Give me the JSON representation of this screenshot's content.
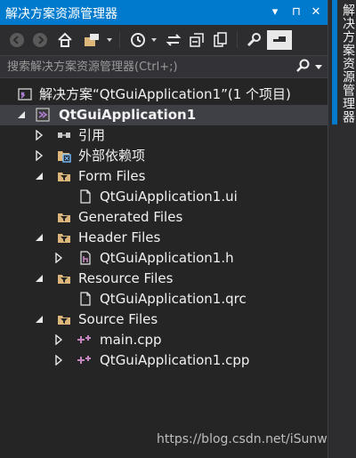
{
  "window": {
    "title": "解决方案资源管理器"
  },
  "title_controls": [
    "▾",
    "⊓",
    "✕"
  ],
  "search": {
    "placeholder": "搜索解决方案资源管理器(Ctrl+;)"
  },
  "sidebar_tab": {
    "label": "解决方案资源管理器"
  },
  "tree": [
    {
      "label": "解决方案“QtGuiApplication1”(1 个项目)",
      "icon": "solution-icon"
    },
    {
      "label": "QtGuiApplication1",
      "icon": "project-icon"
    },
    {
      "label": "引用",
      "icon": "references-icon"
    },
    {
      "label": "外部依赖项",
      "icon": "external-deps-icon"
    },
    {
      "label": "Form Files",
      "icon": "filter-folder-icon"
    },
    {
      "label": "QtGuiApplication1.ui",
      "icon": "file-icon"
    },
    {
      "label": "Generated Files",
      "icon": "filter-folder-icon"
    },
    {
      "label": "Header Files",
      "icon": "filter-folder-icon"
    },
    {
      "label": "QtGuiApplication1.h",
      "icon": "header-file-icon"
    },
    {
      "label": "Resource Files",
      "icon": "filter-folder-icon"
    },
    {
      "label": "QtGuiApplication1.qrc",
      "icon": "file-icon"
    },
    {
      "label": "Source Files",
      "icon": "filter-folder-icon"
    },
    {
      "label": "main.cpp",
      "icon": "cpp-file-icon"
    },
    {
      "label": "QtGuiApplication1.cpp",
      "icon": "cpp-file-icon"
    }
  ],
  "watermark": "https://blog.csdn.net/iSunwish",
  "colors": {
    "accent": "#007acc",
    "background": "#252526",
    "selection": "#3f3f46",
    "folder": "#dcb67a",
    "cpp": "#c586c0"
  }
}
